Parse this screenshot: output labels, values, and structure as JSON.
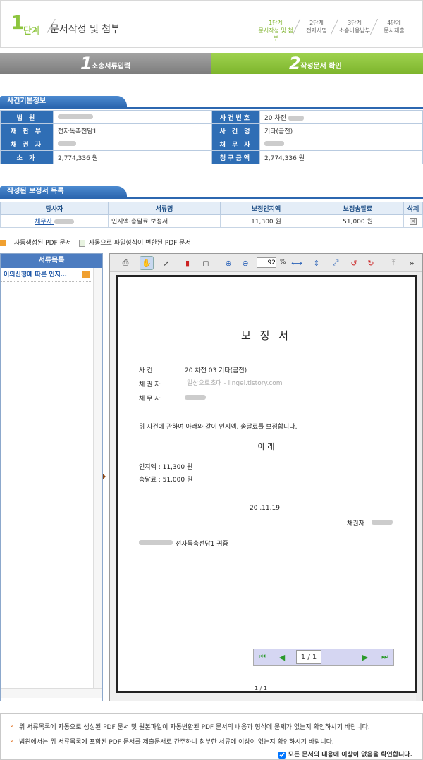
{
  "header": {
    "step_number": "1",
    "step_suffix": "단계",
    "title": "문서작성 및 첨부",
    "steps": [
      {
        "n": "1단계",
        "label": "문서작성 및 첨부",
        "active": true
      },
      {
        "n": "2단계",
        "label": "전자서명",
        "active": false
      },
      {
        "n": "3단계",
        "label": "소송비용납부",
        "active": false
      },
      {
        "n": "4단계",
        "label": "문서제출",
        "active": false
      }
    ]
  },
  "tabs": [
    {
      "num": "1",
      "label": "소송서류입력"
    },
    {
      "num": "2",
      "label": "작성문서 확인"
    }
  ],
  "case_info": {
    "section_title": "사건기본정보",
    "rows": [
      {
        "l1": "법 원",
        "v1": "",
        "l2": "사건번호",
        "v2": "20 차전"
      },
      {
        "l1": "재 판 부",
        "v1": "전자독촉전담1",
        "l2": "사 건 명",
        "v2": "기타(금전)"
      },
      {
        "l1": "채 권 자",
        "v1": "",
        "l2": "채 무 자",
        "v2": ""
      },
      {
        "l1": "소 가",
        "v1": "2,774,336 원",
        "l2": "청구금액",
        "v2": "2,774,336 원"
      }
    ]
  },
  "doc_list": {
    "section_title": "작성된 보정서 목록",
    "headers": [
      "당사자",
      "서류명",
      "보정인지액",
      "보정송달료",
      "삭제"
    ],
    "rows": [
      {
        "party": "채무자",
        "doc": "인지액·송달료 보정서",
        "stamp": "11,300 원",
        "fee": "51,000 원"
      }
    ]
  },
  "legend": {
    "auto": "자동생성된 PDF 문서",
    "converted": "자동으로 파일형식이 변환된 PDF 문서"
  },
  "sidebar": {
    "title": "서류목록",
    "items": [
      "이의신청에 따른 인지…"
    ]
  },
  "viewer": {
    "zoom": "92",
    "zoom_unit": "%",
    "page_current": "1",
    "page_total": "/ 1",
    "page_label": "1 / 1"
  },
  "document": {
    "title": "보 정 서",
    "case_label": "사           건",
    "case_value": "20  차전  03 기타(금전)",
    "creditor_label": "채     권     자",
    "debtor_label": "채     무     자",
    "watermark": "일상으로초대 - lingel.tistory.com",
    "body": "위 사건에 관하여 아래와 같이 인지액, 송달료를 보정합니다.",
    "center": "아               래",
    "stamp_line": "인지액 :  11,300 원",
    "fee_line": "송달료 :  51,000 원",
    "date": "20   .11.19",
    "signer": "채권자",
    "recipient": "전자독촉전담1 귀중"
  },
  "footer": {
    "note1": "위 서류목록에 자동으로 생성된 PDF 문서 및 원본파일이 자동변환된 PDF 문서의 내용과 형식에 문제가 없는지 확인하시기 바랍니다.",
    "note2": "법원에서는 위 서류목록에 포함된 PDF 문서를 제출문서로 간주하니 첨부한 서류에 이상이 없는지 확인하시기 바랍니다.",
    "confirm": "모든 문서의 내용에 이상이 없음을 확인합니다."
  },
  "colors": {
    "green": "#8dc53e",
    "gray_tab": "#8c8c8c",
    "blue": "#2f6eb5"
  }
}
